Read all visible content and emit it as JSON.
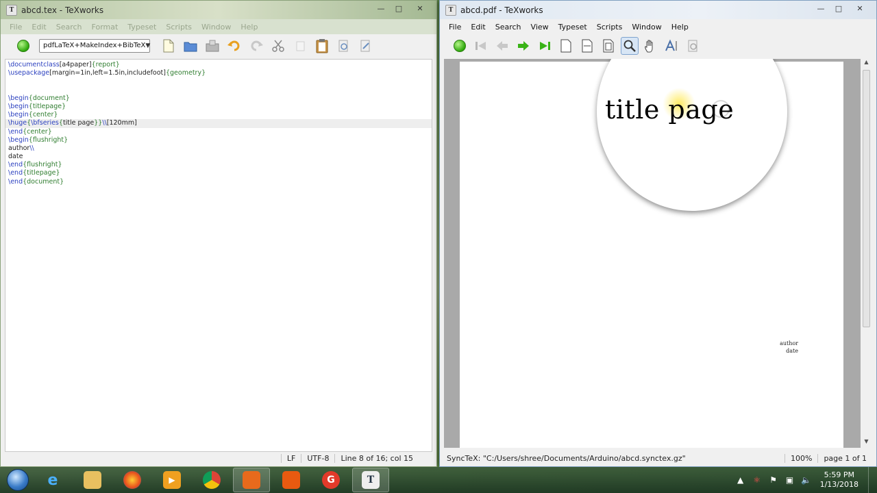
{
  "editor_window": {
    "title": "abcd.tex - TeXworks",
    "menu": [
      "File",
      "Edit",
      "Search",
      "Format",
      "Typeset",
      "Scripts",
      "Window",
      "Help"
    ],
    "engine": "pdfLaTeX+MakeIndex+BibTeX",
    "code_lines": [
      "\\documentclass[a4paper]{report}",
      "\\usepackage[margin=1in,left=1.5in,includefoot]{geometry}",
      "",
      "",
      "\\begin{document}",
      "\\begin{titlepage}",
      "\\begin{center}",
      "\\huge{\\bfseries{title page}}\\\\[120mm]",
      "\\end{center}",
      "\\begin{flushright}",
      "author\\\\",
      "date",
      "\\end{flushright}",
      "\\end{titlepage}",
      "\\end{document}"
    ],
    "status": {
      "line_ending": "LF",
      "encoding": "UTF-8",
      "position": "Line 8 of 16; col 15"
    }
  },
  "pdf_window": {
    "title": "abcd.pdf - TeXworks",
    "menu": [
      "File",
      "Edit",
      "Search",
      "View",
      "Typeset",
      "Scripts",
      "Window",
      "Help"
    ],
    "page_content": {
      "title": "title page",
      "author": "author",
      "date": "date"
    },
    "status": {
      "synctex": "SyncTeX: \"C:/Users/shree/Documents/Arduino/abcd.synctex.gz\"",
      "zoom": "100%",
      "page": "page 1 of 1"
    }
  },
  "taskbar": {
    "time": "5:59 PM",
    "date": "1/13/2018"
  },
  "colors": {
    "keyword": "#2a3fbf",
    "group": "#2f7d2f",
    "typeset_green": "#2ea80c"
  }
}
